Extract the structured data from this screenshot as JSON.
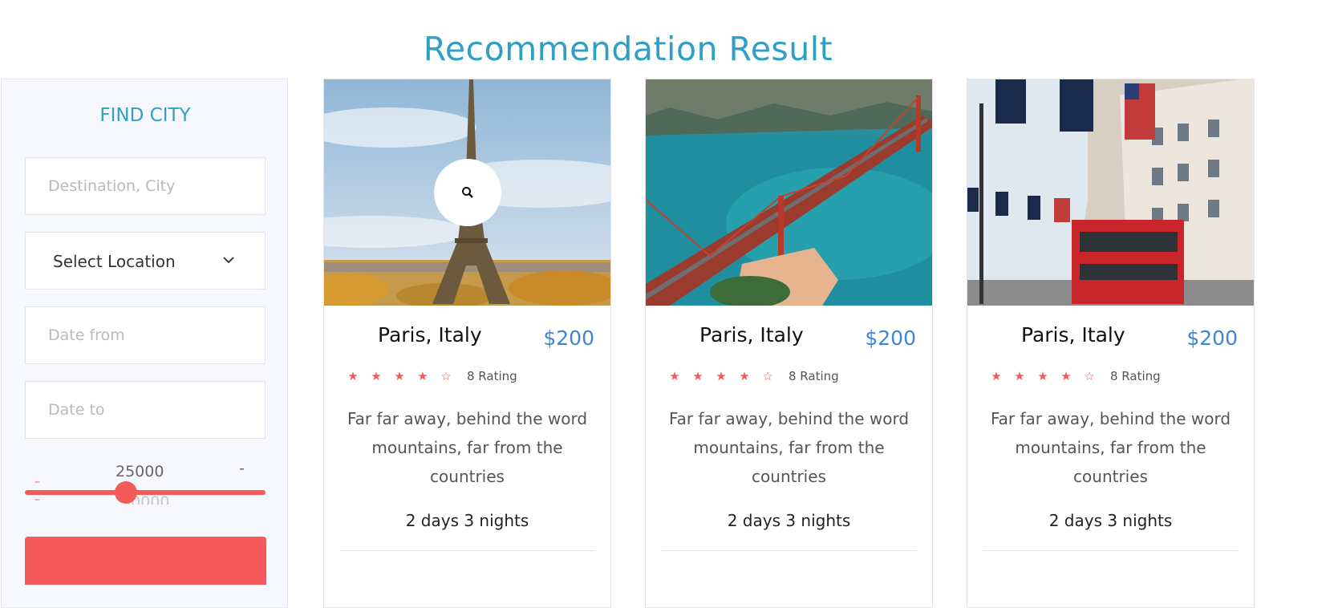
{
  "page": {
    "title": "Recommendation Result"
  },
  "sidebar": {
    "title": "FIND CITY",
    "destination_placeholder": "Destination, City",
    "location_select": "Select Location",
    "date_from_placeholder": "Date from",
    "date_to_placeholder": "Date to",
    "price_range": {
      "min_label": "25000",
      "max_label": "30000",
      "fraction": 0.42
    },
    "accent_color": "#f5595b"
  },
  "cards": [
    {
      "city": "Paris, Italy",
      "price": "$200",
      "stars_filled": 4,
      "stars_total": 5,
      "rating": "8 Rating",
      "description": "Far far away, behind the word mountains, far from the countries",
      "duration": "2 days 3 nights",
      "image": "eiffel-tower-photo"
    },
    {
      "city": "Paris, Italy",
      "price": "$200",
      "stars_filled": 4,
      "stars_total": 5,
      "rating": "8 Rating",
      "description": "Far far away, behind the word mountains, far from the countries",
      "duration": "2 days 3 nights",
      "image": "golden-gate-bridge-photo"
    },
    {
      "city": "Paris, Italy",
      "price": "$200",
      "stars_filled": 4,
      "stars_total": 5,
      "rating": "8 Rating",
      "description": "Far far away, behind the word mountains, far from the countries",
      "duration": "2 days 3 nights",
      "image": "london-street-photo"
    }
  ],
  "colors": {
    "title": "#2f9fc4",
    "price": "#3b86d9",
    "star": "#f35b5b"
  }
}
